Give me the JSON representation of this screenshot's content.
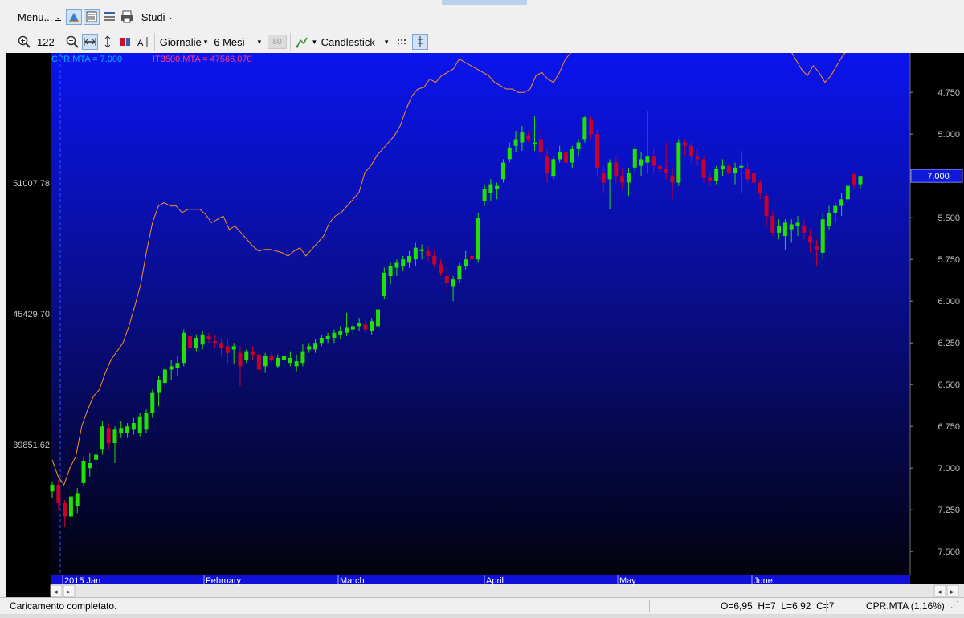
{
  "menubar": {
    "menu_label": "Menu...",
    "studies_label": "Studi"
  },
  "toolbar": {
    "zoom_value": "122",
    "period": "Giornalie",
    "range": "6 Mesi",
    "disabled_value": "80",
    "chart_type": "Candlestick"
  },
  "chart": {
    "legend_primary": "CPR.MTA = 7.000",
    "legend_compare": "IT3500.MTA = 47566.070",
    "current_price_label": "7.000",
    "left_axis_labels": [
      "51007,78",
      "45429,70",
      "39851,62"
    ],
    "right_axis_labels": [
      "7.500",
      "7.250",
      "7.000",
      "6.750",
      "6.500",
      "6.250",
      "6.000",
      "5.750",
      "5.500",
      "5.250",
      "5.000",
      "4.750"
    ],
    "month_labels": [
      "2015 Jan",
      "February",
      "March",
      "April",
      "May",
      "June"
    ],
    "colors": {
      "up": "#22e000",
      "down": "#c8002a",
      "compare_line": "#ff9020",
      "legend_primary": "#00b4ff",
      "legend_compare": "#ff3a8c"
    }
  },
  "chart_data": {
    "type": "candlestick",
    "title": "",
    "ylim": [
      4.65,
      7.65
    ],
    "y_ticks": [
      4.75,
      5.0,
      5.25,
      5.5,
      5.75,
      6.0,
      6.25,
      6.5,
      6.75,
      7.0,
      7.25,
      7.5
    ],
    "compare_ylim_labels": [
      "39851,62",
      "45429,70",
      "51007,78"
    ],
    "series": [
      {
        "name": "CPR.MTA",
        "values": [
          {
            "o": 5.11,
            "h": 5.17,
            "l": 5.07,
            "c": 5.15
          },
          {
            "o": 5.15,
            "h": 5.18,
            "l": 5.0,
            "c": 5.04
          },
          {
            "o": 5.04,
            "h": 5.06,
            "l": 4.9,
            "c": 4.96
          },
          {
            "o": 4.96,
            "h": 5.12,
            "l": 4.88,
            "c": 5.08
          },
          {
            "o": 5.02,
            "h": 5.13,
            "l": 4.98,
            "c": 5.1
          },
          {
            "o": 5.16,
            "h": 5.32,
            "l": 5.14,
            "c": 5.29
          },
          {
            "o": 5.25,
            "h": 5.34,
            "l": 5.2,
            "c": 5.28
          },
          {
            "o": 5.3,
            "h": 5.38,
            "l": 5.24,
            "c": 5.33
          },
          {
            "o": 5.36,
            "h": 5.53,
            "l": 5.33,
            "c": 5.5
          },
          {
            "o": 5.49,
            "h": 5.52,
            "l": 5.36,
            "c": 5.4
          },
          {
            "o": 5.4,
            "h": 5.5,
            "l": 5.28,
            "c": 5.48
          },
          {
            "o": 5.46,
            "h": 5.53,
            "l": 5.43,
            "c": 5.49
          },
          {
            "o": 5.46,
            "h": 5.52,
            "l": 5.43,
            "c": 5.5
          },
          {
            "o": 5.48,
            "h": 5.55,
            "l": 5.45,
            "c": 5.52
          },
          {
            "o": 5.46,
            "h": 5.58,
            "l": 5.44,
            "c": 5.56
          },
          {
            "o": 5.48,
            "h": 5.6,
            "l": 5.46,
            "c": 5.58
          },
          {
            "o": 5.58,
            "h": 5.72,
            "l": 5.55,
            "c": 5.7
          },
          {
            "o": 5.7,
            "h": 5.8,
            "l": 5.62,
            "c": 5.78
          },
          {
            "o": 5.76,
            "h": 5.86,
            "l": 5.73,
            "c": 5.84
          },
          {
            "o": 5.84,
            "h": 5.9,
            "l": 5.78,
            "c": 5.86
          },
          {
            "o": 5.85,
            "h": 5.92,
            "l": 5.8,
            "c": 5.88
          },
          {
            "o": 5.88,
            "h": 6.08,
            "l": 5.86,
            "c": 6.06
          },
          {
            "o": 6.04,
            "h": 6.08,
            "l": 5.94,
            "c": 5.97
          },
          {
            "o": 5.97,
            "h": 6.05,
            "l": 5.95,
            "c": 6.03
          },
          {
            "o": 5.99,
            "h": 6.07,
            "l": 5.96,
            "c": 6.05
          },
          {
            "o": 6.04,
            "h": 6.06,
            "l": 6.0,
            "c": 6.02
          },
          {
            "o": 6.01,
            "h": 6.05,
            "l": 5.97,
            "c": 6.0
          },
          {
            "o": 6.0,
            "h": 6.02,
            "l": 5.92,
            "c": 5.97
          },
          {
            "o": 5.98,
            "h": 6.02,
            "l": 5.88,
            "c": 5.94
          },
          {
            "o": 5.96,
            "h": 6.0,
            "l": 5.87,
            "c": 5.98
          },
          {
            "o": 5.94,
            "h": 5.98,
            "l": 5.74,
            "c": 5.86
          },
          {
            "o": 5.9,
            "h": 5.96,
            "l": 5.88,
            "c": 5.95
          },
          {
            "o": 5.95,
            "h": 5.98,
            "l": 5.9,
            "c": 5.93
          },
          {
            "o": 5.93,
            "h": 5.95,
            "l": 5.8,
            "c": 5.84
          },
          {
            "o": 5.86,
            "h": 5.94,
            "l": 5.82,
            "c": 5.92
          },
          {
            "o": 5.92,
            "h": 5.95,
            "l": 5.88,
            "c": 5.9
          },
          {
            "o": 5.86,
            "h": 5.93,
            "l": 5.85,
            "c": 5.91
          },
          {
            "o": 5.9,
            "h": 5.94,
            "l": 5.86,
            "c": 5.92
          },
          {
            "o": 5.88,
            "h": 5.95,
            "l": 5.86,
            "c": 5.91
          },
          {
            "o": 5.86,
            "h": 5.93,
            "l": 5.83,
            "c": 5.89
          },
          {
            "o": 5.88,
            "h": 5.99,
            "l": 5.86,
            "c": 5.95
          },
          {
            "o": 5.96,
            "h": 6.0,
            "l": 5.94,
            "c": 5.98
          },
          {
            "o": 5.96,
            "h": 6.02,
            "l": 5.94,
            "c": 6.0
          },
          {
            "o": 6.0,
            "h": 6.05,
            "l": 5.98,
            "c": 6.03
          },
          {
            "o": 6.02,
            "h": 6.06,
            "l": 6.0,
            "c": 6.04
          },
          {
            "o": 6.03,
            "h": 6.08,
            "l": 6.0,
            "c": 6.06
          },
          {
            "o": 6.05,
            "h": 6.1,
            "l": 6.02,
            "c": 6.07
          },
          {
            "o": 6.06,
            "h": 6.18,
            "l": 6.04,
            "c": 6.09
          },
          {
            "o": 6.08,
            "h": 6.12,
            "l": 6.05,
            "c": 6.1
          },
          {
            "o": 6.1,
            "h": 6.15,
            "l": 6.07,
            "c": 6.12
          },
          {
            "o": 6.11,
            "h": 6.14,
            "l": 6.06,
            "c": 6.08
          },
          {
            "o": 6.07,
            "h": 6.15,
            "l": 6.05,
            "c": 6.13
          },
          {
            "o": 6.1,
            "h": 6.25,
            "l": 6.08,
            "c": 6.2
          },
          {
            "o": 6.28,
            "h": 6.45,
            "l": 6.26,
            "c": 6.42
          },
          {
            "o": 6.4,
            "h": 6.48,
            "l": 6.35,
            "c": 6.46
          },
          {
            "o": 6.45,
            "h": 6.5,
            "l": 6.4,
            "c": 6.48
          },
          {
            "o": 6.46,
            "h": 6.52,
            "l": 6.43,
            "c": 6.5
          },
          {
            "o": 6.48,
            "h": 6.55,
            "l": 6.45,
            "c": 6.52
          },
          {
            "o": 6.5,
            "h": 6.6,
            "l": 6.46,
            "c": 6.57
          },
          {
            "o": 6.55,
            "h": 6.59,
            "l": 6.5,
            "c": 6.56
          },
          {
            "o": 6.55,
            "h": 6.58,
            "l": 6.49,
            "c": 6.52
          },
          {
            "o": 6.52,
            "h": 6.56,
            "l": 6.45,
            "c": 6.47
          },
          {
            "o": 6.47,
            "h": 6.5,
            "l": 6.4,
            "c": 6.42
          },
          {
            "o": 6.4,
            "h": 6.45,
            "l": 6.3,
            "c": 6.36
          },
          {
            "o": 6.34,
            "h": 6.4,
            "l": 6.25,
            "c": 6.38
          },
          {
            "o": 6.38,
            "h": 6.48,
            "l": 6.36,
            "c": 6.46
          },
          {
            "o": 6.46,
            "h": 6.55,
            "l": 6.44,
            "c": 6.5
          },
          {
            "o": 6.52,
            "h": 6.56,
            "l": 6.48,
            "c": 6.5
          },
          {
            "o": 6.5,
            "h": 6.78,
            "l": 6.48,
            "c": 6.75
          },
          {
            "o": 6.85,
            "h": 6.95,
            "l": 6.82,
            "c": 6.92
          },
          {
            "o": 6.9,
            "h": 6.98,
            "l": 6.85,
            "c": 6.95
          },
          {
            "o": 6.92,
            "h": 6.96,
            "l": 6.86,
            "c": 6.94
          },
          {
            "o": 6.98,
            "h": 7.1,
            "l": 6.96,
            "c": 7.08
          },
          {
            "o": 7.1,
            "h": 7.2,
            "l": 7.08,
            "c": 7.17
          },
          {
            "o": 7.18,
            "h": 7.27,
            "l": 7.14,
            "c": 7.22
          },
          {
            "o": 7.2,
            "h": 7.3,
            "l": 7.15,
            "c": 7.26
          },
          {
            "o": 7.24,
            "h": 7.27,
            "l": 7.2,
            "c": 7.22
          },
          {
            "o": 7.2,
            "h": 7.36,
            "l": 7.15,
            "c": 7.2
          },
          {
            "o": 7.22,
            "h": 7.28,
            "l": 7.1,
            "c": 7.14
          },
          {
            "o": 7.12,
            "h": 7.16,
            "l": 6.96,
            "c": 7.02
          },
          {
            "o": 7.0,
            "h": 7.12,
            "l": 6.98,
            "c": 7.1
          },
          {
            "o": 7.1,
            "h": 7.18,
            "l": 7.08,
            "c": 7.14
          },
          {
            "o": 7.14,
            "h": 7.17,
            "l": 7.05,
            "c": 7.08
          },
          {
            "o": 7.08,
            "h": 7.18,
            "l": 7.05,
            "c": 7.16
          },
          {
            "o": 7.16,
            "h": 7.22,
            "l": 7.12,
            "c": 7.2
          },
          {
            "o": 7.22,
            "h": 7.36,
            "l": 7.2,
            "c": 7.35
          },
          {
            "o": 7.34,
            "h": 7.36,
            "l": 7.22,
            "c": 7.25
          },
          {
            "o": 7.25,
            "h": 7.28,
            "l": 7.0,
            "c": 7.05
          },
          {
            "o": 7.02,
            "h": 7.06,
            "l": 6.9,
            "c": 6.96
          },
          {
            "o": 6.98,
            "h": 7.1,
            "l": 6.8,
            "c": 7.08
          },
          {
            "o": 7.08,
            "h": 7.12,
            "l": 6.96,
            "c": 7.0
          },
          {
            "o": 7.0,
            "h": 7.04,
            "l": 6.92,
            "c": 6.96
          },
          {
            "o": 6.96,
            "h": 7.05,
            "l": 6.88,
            "c": 7.02
          },
          {
            "o": 7.05,
            "h": 7.18,
            "l": 7.02,
            "c": 7.16
          },
          {
            "o": 7.06,
            "h": 7.14,
            "l": 7.0,
            "c": 7.1
          },
          {
            "o": 7.08,
            "h": 7.39,
            "l": 7.02,
            "c": 7.12
          },
          {
            "o": 7.12,
            "h": 7.16,
            "l": 7.02,
            "c": 7.06
          },
          {
            "o": 7.06,
            "h": 7.1,
            "l": 6.98,
            "c": 7.04
          },
          {
            "o": 7.04,
            "h": 7.2,
            "l": 6.98,
            "c": 7.02
          },
          {
            "o": 7.0,
            "h": 7.05,
            "l": 6.86,
            "c": 6.96
          },
          {
            "o": 6.96,
            "h": 7.22,
            "l": 6.94,
            "c": 7.2
          },
          {
            "o": 7.2,
            "h": 7.22,
            "l": 7.12,
            "c": 7.18
          },
          {
            "o": 7.18,
            "h": 7.2,
            "l": 7.08,
            "c": 7.12
          },
          {
            "o": 7.12,
            "h": 7.16,
            "l": 7.06,
            "c": 7.1
          },
          {
            "o": 7.1,
            "h": 7.12,
            "l": 6.96,
            "c": 6.99
          },
          {
            "o": 6.99,
            "h": 7.02,
            "l": 6.94,
            "c": 6.97
          },
          {
            "o": 6.97,
            "h": 7.06,
            "l": 6.95,
            "c": 7.04
          },
          {
            "o": 7.04,
            "h": 7.1,
            "l": 7.0,
            "c": 7.06
          },
          {
            "o": 7.06,
            "h": 7.08,
            "l": 7.0,
            "c": 7.02
          },
          {
            "o": 7.02,
            "h": 7.08,
            "l": 6.95,
            "c": 7.05
          },
          {
            "o": 7.05,
            "h": 7.15,
            "l": 6.9,
            "c": 7.06
          },
          {
            "o": 7.04,
            "h": 7.08,
            "l": 6.96,
            "c": 6.98
          },
          {
            "o": 7.02,
            "h": 7.04,
            "l": 6.93,
            "c": 6.96
          },
          {
            "o": 6.96,
            "h": 6.98,
            "l": 6.86,
            "c": 6.9
          },
          {
            "o": 6.88,
            "h": 6.9,
            "l": 6.7,
            "c": 6.76
          },
          {
            "o": 6.76,
            "h": 6.79,
            "l": 6.64,
            "c": 6.66
          },
          {
            "o": 6.66,
            "h": 6.74,
            "l": 6.62,
            "c": 6.7
          },
          {
            "o": 6.64,
            "h": 6.74,
            "l": 6.56,
            "c": 6.72
          },
          {
            "o": 6.68,
            "h": 6.74,
            "l": 6.6,
            "c": 6.71
          },
          {
            "o": 6.7,
            "h": 6.76,
            "l": 6.64,
            "c": 6.72
          },
          {
            "o": 6.7,
            "h": 6.74,
            "l": 6.62,
            "c": 6.66
          },
          {
            "o": 6.64,
            "h": 6.68,
            "l": 6.54,
            "c": 6.6
          },
          {
            "o": 6.58,
            "h": 6.62,
            "l": 6.46,
            "c": 6.56
          },
          {
            "o": 6.54,
            "h": 6.78,
            "l": 6.5,
            "c": 6.74
          },
          {
            "o": 6.7,
            "h": 6.82,
            "l": 6.68,
            "c": 6.78
          },
          {
            "o": 6.78,
            "h": 6.84,
            "l": 6.72,
            "c": 6.82
          },
          {
            "o": 6.82,
            "h": 6.9,
            "l": 6.76,
            "c": 6.86
          },
          {
            "o": 6.86,
            "h": 6.96,
            "l": 6.84,
            "c": 6.94
          },
          {
            "o": 7.01,
            "h": 7.02,
            "l": 6.92,
            "c": 6.95
          },
          {
            "o": 6.95,
            "h": 7.0,
            "l": 6.92,
            "c": 7.0
          }
        ]
      },
      {
        "name": "IT3500.MTA",
        "values_normalized": [
          0.3,
          0.2,
          0.15,
          0.25,
          0.32,
          0.5,
          0.6,
          0.68,
          0.72,
          0.82,
          0.9,
          0.95,
          1.0,
          1.1,
          1.22,
          1.35,
          1.55,
          1.72,
          1.82,
          1.84,
          1.82,
          1.82,
          1.78,
          1.8,
          1.8,
          1.8,
          1.77,
          1.72,
          1.74,
          1.76,
          1.68,
          1.7,
          1.66,
          1.62,
          1.58,
          1.55,
          1.56,
          1.56,
          1.55,
          1.54,
          1.52,
          1.55,
          1.57,
          1.52,
          1.56,
          1.6,
          1.64,
          1.72,
          1.76,
          1.78,
          1.82,
          1.86,
          1.9,
          2.02,
          2.06,
          2.12,
          2.16,
          2.2,
          2.24,
          2.3,
          2.4,
          2.48,
          2.52,
          2.53,
          2.58,
          2.56,
          2.6,
          2.62,
          2.64,
          2.7,
          2.68,
          2.66,
          2.64,
          2.62,
          2.6,
          2.56,
          2.54,
          2.52,
          2.52,
          2.5,
          2.5,
          2.52,
          2.6,
          2.62,
          2.58,
          2.56,
          2.62,
          2.7,
          2.74,
          2.86,
          2.92,
          2.98,
          3.05,
          3.1,
          3.14,
          3.16,
          3.18,
          3.16,
          3.12,
          3.08,
          3.0,
          2.95,
          2.98,
          3.02,
          3.04,
          3.08,
          3.14,
          3.18,
          3.16,
          3.12,
          3.1,
          3.02,
          3.12,
          3.02,
          2.96,
          2.98,
          2.94,
          2.9,
          2.82,
          2.78,
          2.82,
          2.86,
          2.9,
          2.92,
          2.86,
          2.76,
          2.7,
          2.64,
          2.6,
          2.66,
          2.62,
          2.56,
          2.6,
          2.66,
          2.72,
          2.76,
          2.8,
          2.9
        ]
      }
    ]
  },
  "status": {
    "message": "Caricamento completato.",
    "ohlc": "O=6,95  H=7  L=6,92  C=7",
    "symbol_change": "CPR.MTA (1,16%)"
  }
}
